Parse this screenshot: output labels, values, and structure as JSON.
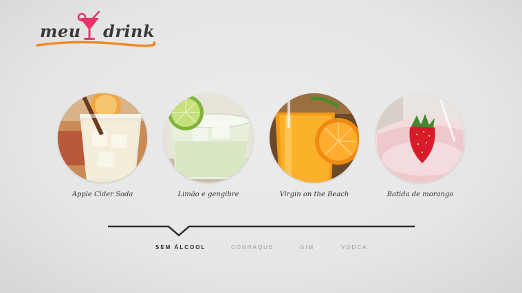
{
  "logo": {
    "word1": "meu",
    "word2": "drink",
    "accent_color": "#e8336b",
    "swoosh_color": "#f08a2a"
  },
  "drinks": [
    {
      "name": "Apple Cider Soda"
    },
    {
      "name": "Limão e gengibre"
    },
    {
      "name": "Virgin on the Beach"
    },
    {
      "name": "Batida de morango"
    }
  ],
  "tabs": [
    {
      "label": "SEM ÁLCOOL",
      "active": true
    },
    {
      "label": "CONHAQUE",
      "active": false
    },
    {
      "label": "GIM",
      "active": false
    },
    {
      "label": "VODCA",
      "active": false
    }
  ]
}
